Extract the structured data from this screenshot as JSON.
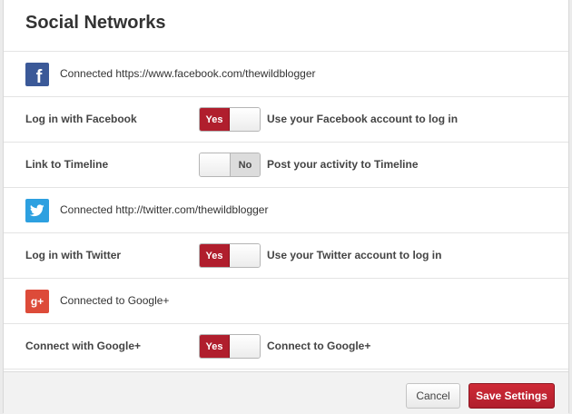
{
  "title": "Social Networks",
  "facebook": {
    "icon": "facebook-icon",
    "icon_glyph": "f",
    "connected_text": "Connected https://www.facebook.com/thewildblogger",
    "settings": [
      {
        "label": "Log in with Facebook",
        "state": "Yes",
        "on": true,
        "description": "Use your Facebook account to log in"
      },
      {
        "label": "Link to Timeline",
        "state": "No",
        "on": false,
        "description": "Post your activity to Timeline"
      }
    ]
  },
  "twitter": {
    "icon": "twitter-icon",
    "connected_text": "Connected http://twitter.com/thewildblogger",
    "settings": [
      {
        "label": "Log in with Twitter",
        "state": "Yes",
        "on": true,
        "description": "Use your Twitter account to log in"
      }
    ]
  },
  "google": {
    "icon": "google-plus-icon",
    "icon_glyph": "g+",
    "connected_text": "Connected to Google+",
    "settings": [
      {
        "label": "Connect with Google+",
        "state": "Yes",
        "on": true,
        "description": "Connect to Google+"
      }
    ]
  },
  "footer": {
    "cancel_label": "Cancel",
    "save_label": "Save Settings"
  },
  "colors": {
    "accent": "#b01e2d",
    "facebook": "#3b5998",
    "twitter": "#2da0e0",
    "google": "#dd4b39"
  }
}
